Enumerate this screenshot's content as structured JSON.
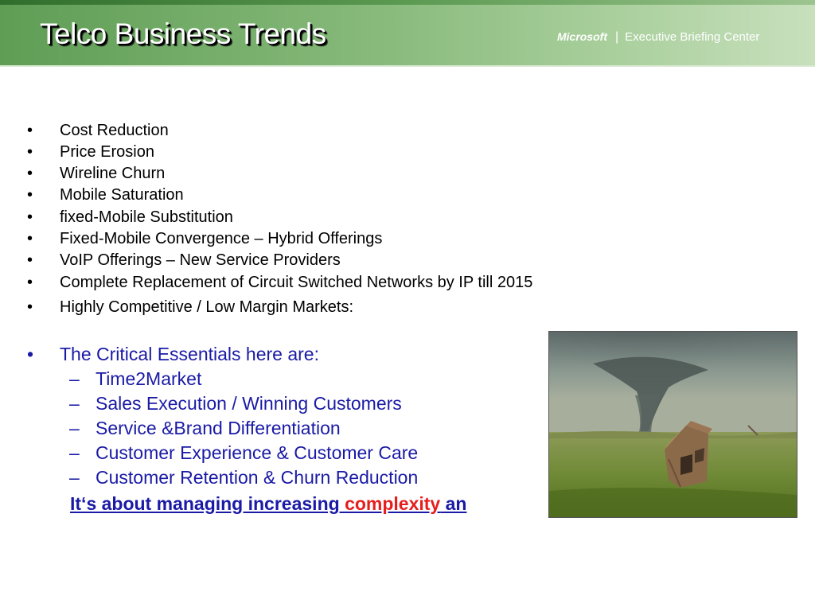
{
  "header": {
    "title": "Telco Business Trends",
    "brand_microsoft": "Microsoft",
    "brand_separator": "|",
    "brand_center": "Executive Briefing Center"
  },
  "bullets": [
    "Cost Reduction",
    "Price Erosion",
    "Wireline Churn",
    "Mobile Saturation",
    "fixed-Mobile Substitution",
    "Fixed-Mobile Convergence – Hybrid Offerings",
    "VoIP Offerings – New Service Providers",
    "Complete Replacement of Circuit Switched Networks by IP till 2015",
    "Highly Competitive / Low Margin Markets:"
  ],
  "critical": {
    "heading": "The Critical Essentials here are:",
    "items": [
      "Time2Market",
      "Sales Execution / Winning Customers",
      "Service &Brand Differentiation",
      "Customer Experience & Customer Care",
      "Customer Retention & Churn Reduction"
    ]
  },
  "closing": {
    "part1": "It‘s about managing increasing ",
    "part2": "complexity",
    "part3": " an"
  },
  "bullet_glyph": "•",
  "dash_glyph": "–",
  "colors": {
    "header_green": "#5f9d55",
    "text_blue": "#1a1aa6",
    "accent_red": "#e61e1e"
  }
}
